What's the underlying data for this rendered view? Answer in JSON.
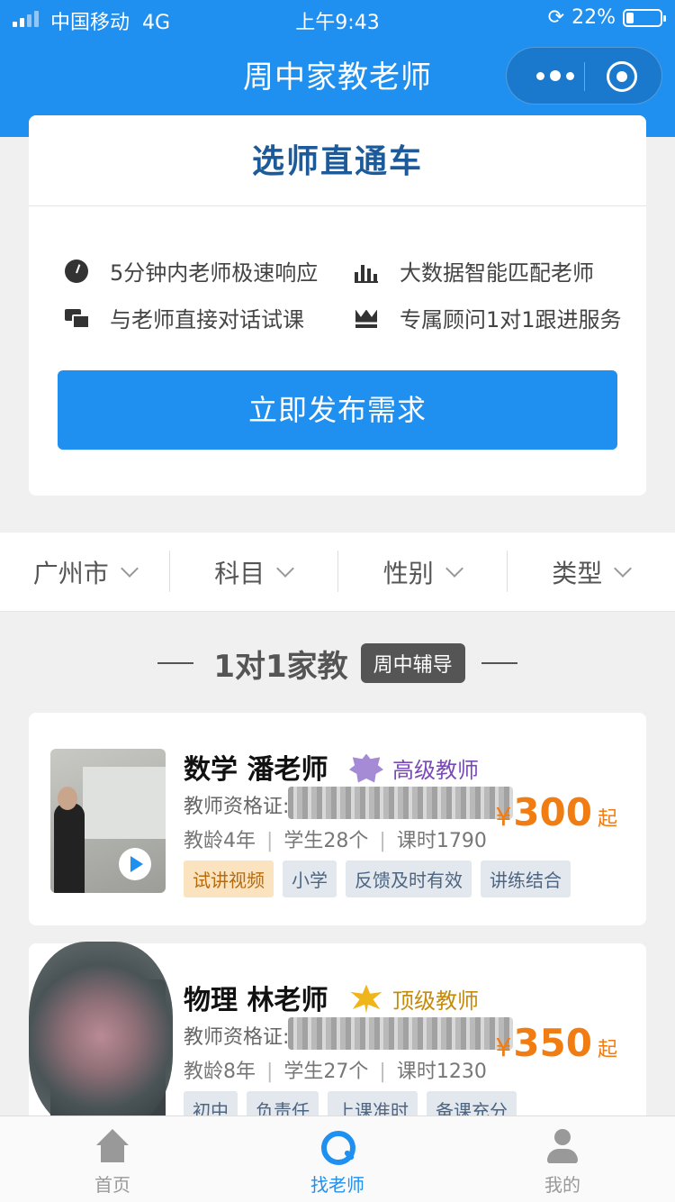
{
  "status_bar": {
    "carrier": "中国移动",
    "network": "4G",
    "time": "上午9:43",
    "battery": "22%",
    "battery_level": 0.22
  },
  "nav": {
    "title": "周中家教老师"
  },
  "promo": {
    "title": "选师直通车",
    "features": [
      {
        "text": "5分钟内老师极速响应",
        "icon": "clock-icon"
      },
      {
        "text": "大数据智能匹配老师",
        "icon": "bar-chart-icon"
      },
      {
        "text": "与老师直接对话试课",
        "icon": "chat-icon"
      },
      {
        "text": "专属顾问1对1跟进服务",
        "icon": "crown-icon"
      }
    ],
    "button": "立即发布需求"
  },
  "filters": [
    "广州市",
    "科目",
    "性别",
    "类型"
  ],
  "section": {
    "title": "1对1家教",
    "badge": "周中辅导"
  },
  "teachers": [
    {
      "name": "数学 潘老师",
      "level": "高级教师",
      "cert_label": "教师资格证:",
      "age": "教龄4年",
      "students": "学生28个",
      "hours": "课时1790",
      "currency": "¥",
      "price": "300",
      "price_unit": "起",
      "tags": [
        "试讲视频",
        "小学",
        "反馈及时有效",
        "讲练结合"
      ]
    },
    {
      "name": "物理 林老师",
      "level": "顶级教师",
      "cert_label": "教师资格证:",
      "age": "教龄8年",
      "students": "学生27个",
      "hours": "课时1230",
      "currency": "¥",
      "price": "350",
      "price_unit": "起",
      "tags": [
        "初中",
        "负责任",
        "上课准时",
        "备课充分"
      ]
    }
  ],
  "tabbar": [
    {
      "label": "首页",
      "icon": "home-icon",
      "active": false
    },
    {
      "label": "找老师",
      "icon": "search-icon",
      "active": true
    },
    {
      "label": "我的",
      "icon": "user-icon",
      "active": false
    }
  ],
  "colors": {
    "primary": "#1f8ff0",
    "price": "#f07c12",
    "promo_title": "#1d5a9a",
    "level_senior": "#7a49b8",
    "level_top": "#c48b0c"
  }
}
